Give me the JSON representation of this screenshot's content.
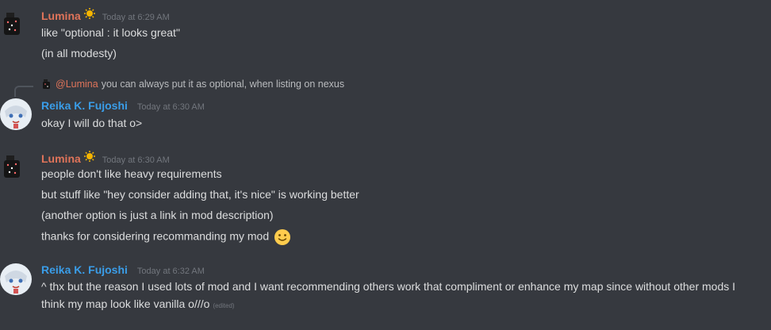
{
  "users": {
    "lumina": {
      "name": "Lumina",
      "color": "#e0745a",
      "badge_icon": "sun-icon"
    },
    "reika": {
      "name": "Reika K. Fujoshi",
      "color": "#3a9de8"
    }
  },
  "messages": [
    {
      "author": "Lumina",
      "timestamp": "Today at 6:29 AM",
      "lines": [
        "like \"optional : it looks great\"",
        "(in all modesty)"
      ]
    },
    {
      "reply": {
        "mention": "@Lumina",
        "text": "you can always put it as optional, when listing on nexus"
      },
      "author": "Reika K. Fujoshi",
      "timestamp": "Today at 6:30 AM",
      "lines": [
        "okay I will do that o>"
      ]
    },
    {
      "author": "Lumina",
      "timestamp": "Today at 6:30 AM",
      "lines": [
        "people don't like heavy requirements",
        "but stuff like \"hey consider adding that, it's nice\" is working better",
        "(another option is just a link in mod description)",
        "thanks for considering recommanding my mod"
      ],
      "emoji": "slight-smile-emoji"
    },
    {
      "author": "Reika K. Fujoshi",
      "timestamp": "Today at 6:32 AM",
      "lines": [
        "^ thx but the reason I used lots of mod and I want recommending others work that compliment or enhance my map since without other mods I think my map look like vanilla o///o"
      ],
      "edited": "(edited)"
    }
  ]
}
